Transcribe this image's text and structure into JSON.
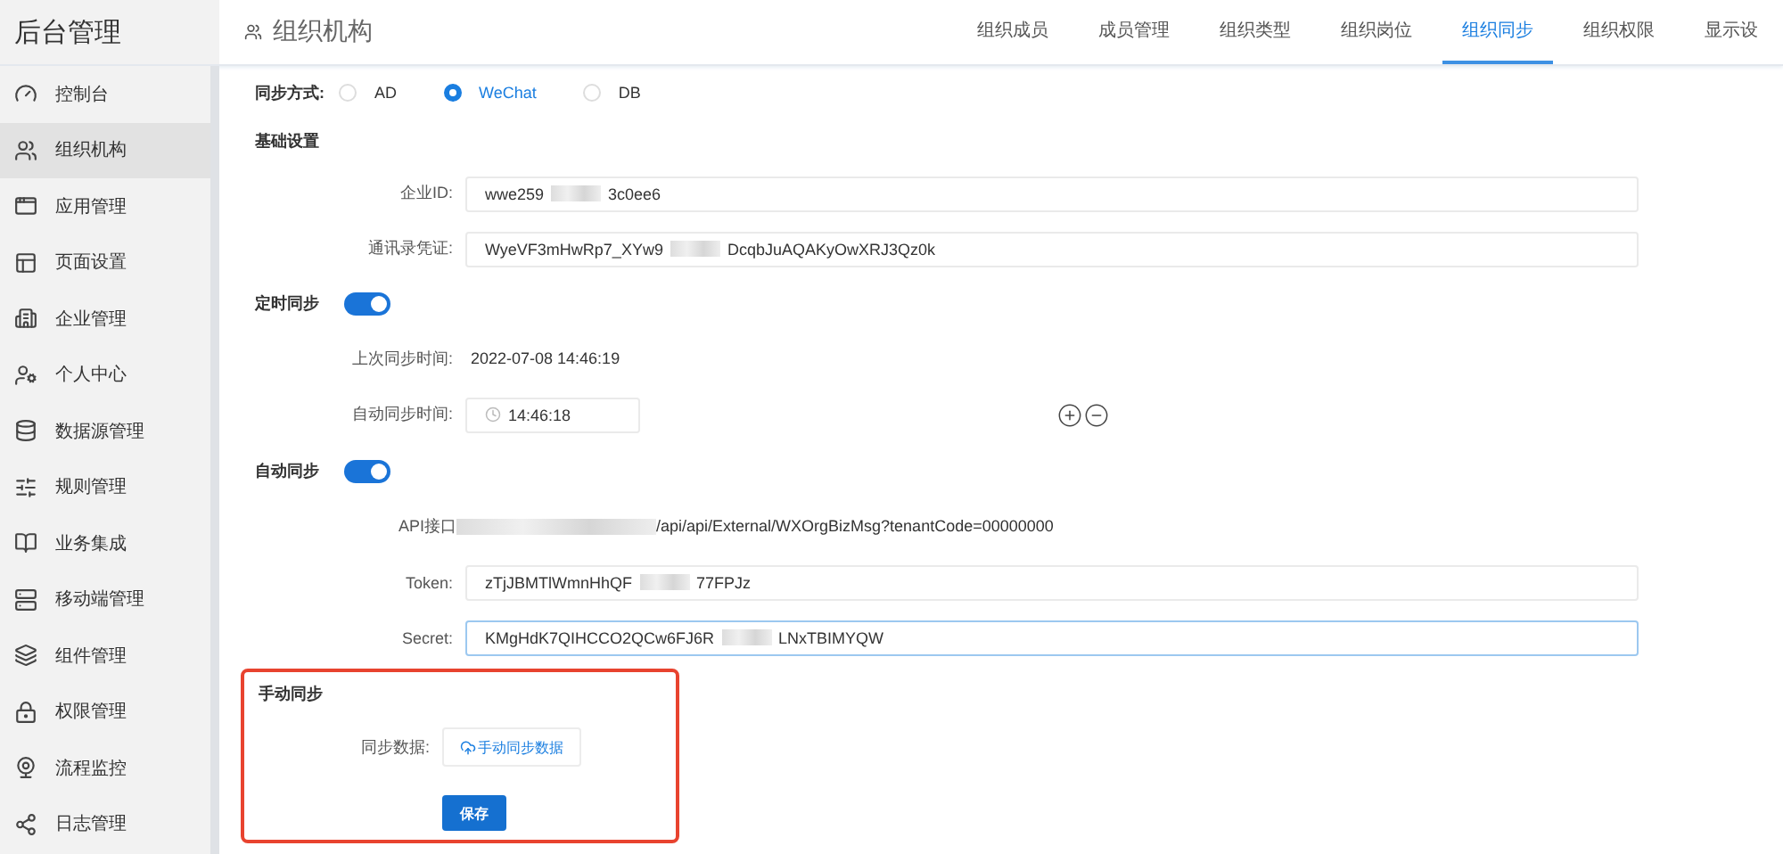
{
  "app_title": "后台管理",
  "sidebar": {
    "items": [
      {
        "label": "控制台",
        "selected": false
      },
      {
        "label": "组织机构",
        "selected": true
      },
      {
        "label": "应用管理",
        "selected": false
      },
      {
        "label": "页面设置",
        "selected": false
      },
      {
        "label": "企业管理",
        "selected": false
      },
      {
        "label": "个人中心",
        "selected": false
      },
      {
        "label": "数据源管理",
        "selected": false
      },
      {
        "label": "规则管理",
        "selected": false
      },
      {
        "label": "业务集成",
        "selected": false
      },
      {
        "label": "移动端管理",
        "selected": false
      },
      {
        "label": "组件管理",
        "selected": false
      },
      {
        "label": "权限管理",
        "selected": false
      },
      {
        "label": "流程监控",
        "selected": false
      },
      {
        "label": "日志管理",
        "selected": false
      }
    ]
  },
  "page_title": "组织机构",
  "tabs": [
    {
      "label": "组织成员",
      "selected": false
    },
    {
      "label": "成员管理",
      "selected": false
    },
    {
      "label": "组织类型",
      "selected": false
    },
    {
      "label": "组织岗位",
      "selected": false
    },
    {
      "label": "组织同步",
      "selected": true
    },
    {
      "label": "组织权限",
      "selected": false
    },
    {
      "label": "显示设",
      "selected": false
    }
  ],
  "sync_mode": {
    "label": "同步方式:",
    "options": [
      {
        "label": "AD",
        "selected": false
      },
      {
        "label": "WeChat",
        "selected": true
      },
      {
        "label": "DB",
        "selected": false
      }
    ]
  },
  "basic": {
    "title": "基础设置",
    "fields": [
      {
        "label": "企业ID:",
        "value_parts": [
          "wwe259",
          "3c0ee6"
        ],
        "focused": false
      },
      {
        "label": "通讯录凭证:",
        "value_parts": [
          "WyeVF3mHwRp7_XYw9",
          "DcqbJuAQAKyOwXRJ3Qz0k"
        ],
        "focused": false
      }
    ]
  },
  "scheduled": {
    "title": "定时同步",
    "on": true,
    "last_sync_label": "上次同步时间:",
    "last_sync": "2022-07-08 14:46:19",
    "auto_time_label": "自动同步时间:",
    "auto_time": "14:46:18"
  },
  "auto": {
    "title": "自动同步",
    "on": true,
    "api_label": "API接口",
    "api_url": "/api/api/External/WXOrgBizMsg?tenantCode=00000000",
    "fields": [
      {
        "label": "Token:",
        "value_parts": [
          "zTjJBMTlWmnHhQF",
          "77FPJz"
        ],
        "focused": false
      },
      {
        "label": "Secret:",
        "value_parts": [
          "KMgHdK7QIHCCO2QCw6FJ6R",
          "LNxTBIMYQW"
        ],
        "focused": true
      }
    ]
  },
  "manual": {
    "title": "手动同步",
    "data_label": "同步数据:",
    "sync_button": "手动同步数据",
    "save_button": "保存"
  }
}
